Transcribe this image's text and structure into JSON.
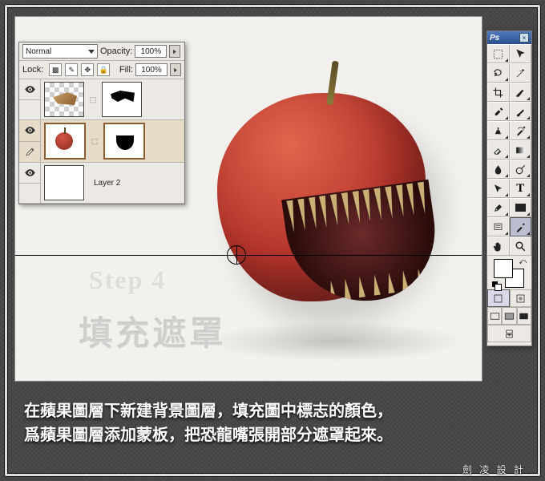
{
  "app": {
    "name": "Ps"
  },
  "layers_panel": {
    "blend_mode": "Normal",
    "opacity_label": "Opacity:",
    "opacity_value": "100%",
    "lock_label": "Lock:",
    "fill_label": "Fill:",
    "fill_value": "100%",
    "layers": [
      {
        "label": ""
      },
      {
        "label": ""
      },
      {
        "label": "Layer 2"
      }
    ]
  },
  "canvas": {
    "step_label": "Step 4",
    "step_title": "填充遮罩"
  },
  "caption": {
    "line1": "在蘋果圖層下新建背景圖層，填充圖中標志的顏色，",
    "line2": "爲蘋果圖層添加蒙板，把恐龍嘴張開部分遮罩起來。"
  },
  "credit": "劍 凌 設 計",
  "tools": {
    "items": [
      "move",
      "marquee",
      "lasso",
      "magic-wand",
      "crop",
      "slice",
      "healing",
      "brush",
      "stamp",
      "history-brush",
      "eraser",
      "gradient",
      "blur",
      "dodge",
      "pen",
      "type",
      "path-select",
      "shape",
      "notes",
      "eyedropper",
      "hand",
      "zoom"
    ],
    "active": "eyedropper"
  }
}
